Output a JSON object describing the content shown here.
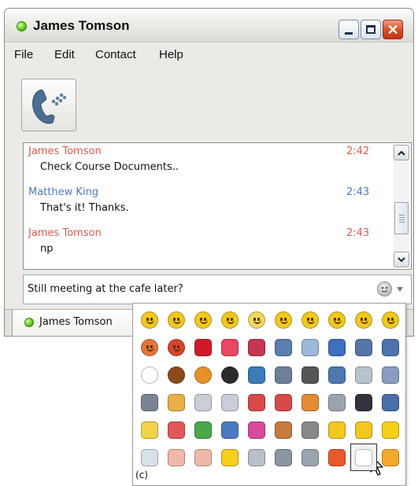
{
  "window": {
    "title": "James Tomson"
  },
  "menu": {
    "items": [
      "File",
      "Edit",
      "Contact",
      "Help"
    ]
  },
  "chat": {
    "messages": [
      {
        "sender": "James Tomson",
        "time": "2:42",
        "text": "Check Course Documents..",
        "color": "#e05a4b"
      },
      {
        "sender": "Matthew King",
        "time": "2:43",
        "text": "That's it! Thanks.",
        "color": "#4a78c0"
      },
      {
        "sender": "James Tomson",
        "time": "2:43",
        "text": "np",
        "color": "#e05a4b"
      }
    ]
  },
  "input": {
    "value": "Still meeting at the cafe later?"
  },
  "tabs": [
    {
      "label": "James Tomson",
      "status": "online"
    }
  ],
  "emoticons": {
    "rows": [
      [
        "smile-icon",
        "grin-icon",
        "big-grin-icon",
        "sad-icon",
        "confused-icon",
        "smirk-icon",
        "cool-icon",
        "neutral-icon",
        "wink-icon",
        "unhappy-icon"
      ],
      [
        "angry-icon",
        "devil-icon",
        "lips-icon",
        "heart-icon",
        "broken-heart-icon",
        "notebook-icon",
        "envelope-icon",
        "bar-chart-icon",
        "book-icon",
        "phone-book-icon"
      ],
      [
        "soccer-ball-icon",
        "football-icon",
        "basketball-icon",
        "eight-ball-icon",
        "telephone-icon",
        "television-icon",
        "music-note-icon",
        "computer-icon",
        "mobile-device-icon",
        "paint-palette-icon"
      ],
      [
        "webcam-icon",
        "beer-icon",
        "cocktail-icon",
        "wine-glass-icon",
        "boy-icon",
        "girl-icon",
        "people-icon",
        "film-reel-icon",
        "bat-icon",
        "car-icon"
      ],
      [
        "birthday-cake-icon",
        "gift-icon",
        "money-icon",
        "male-symbol-icon",
        "female-symbol-icon",
        "house-icon",
        "sleeping-icon",
        "warning-icon",
        "lightning-icon",
        "star-icon"
      ],
      [
        "eye-icon",
        "thumbs-up-icon",
        "thumbs-down-icon",
        "sun-icon",
        "partly-cloudy-icon",
        "rain-cloud-icon",
        "snow-cloud-icon",
        "rainbow-icon",
        "coffee-icon",
        "clock-icon"
      ]
    ],
    "colors": [
      [
        "#f2c81e",
        "#f2c81e",
        "#f2c81e",
        "#f2c81e",
        "#f0d860",
        "#f2c81e",
        "#f2c81e",
        "#f2c81e",
        "#f2c81e",
        "#f2c81e"
      ],
      [
        "#e6743a",
        "#d9452a",
        "#d2192a",
        "#e84863",
        "#c43652",
        "#5a7fb0",
        "#9db8d8",
        "#3d6fc0",
        "#5576a8",
        "#4d72ad"
      ],
      [
        "#ffffff",
        "#8b4a1c",
        "#e8902a",
        "#2b2b2b",
        "#3a7bb8",
        "#6b7f98",
        "#555555",
        "#4f78b0",
        "#b9c2cc",
        "#8a9cc0"
      ],
      [
        "#7a8494",
        "#e8b04a",
        "#c9ced8",
        "#c9ced8",
        "#d84a4a",
        "#d84a4a",
        "#e28a34",
        "#9aa3b0",
        "#333340",
        "#4a6ea8"
      ],
      [
        "#f2d24a",
        "#e25858",
        "#4aa84a",
        "#4a7ac0",
        "#d84a9a",
        "#c87a3a",
        "#888888",
        "#f2c81e",
        "#f2c81e",
        "#f5cf1a"
      ],
      [
        "#d8e0ea",
        "#f0b8a8",
        "#f0b8a8",
        "#f5cf1a",
        "#b8bfc8",
        "#8b95a3",
        "#9aa3b0",
        "#e8582a",
        "#ffffff",
        "#f2a82a"
      ]
    ],
    "selected": "coffee-icon",
    "footer_code": "(c)"
  }
}
